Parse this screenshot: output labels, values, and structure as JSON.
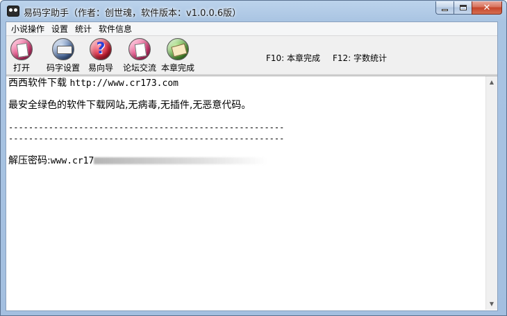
{
  "window": {
    "title": "易码字助手（作者：创世魂，软件版本：v1.0.0.6版）",
    "minimize_glyph": "–",
    "maximize_glyph": "□",
    "close_glyph": "✕"
  },
  "menu": {
    "items": [
      "小说操作",
      "设置",
      "统计",
      "软件信息"
    ]
  },
  "toolbar": {
    "buttons": [
      {
        "label": "打开",
        "icon": "open-file-icon"
      },
      {
        "label": "码字设置",
        "icon": "settings-icon"
      },
      {
        "label": "易向导",
        "icon": "wizard-help-icon"
      },
      {
        "label": "论坛交流",
        "icon": "forum-icon"
      },
      {
        "label": "本章完成",
        "icon": "chapter-complete-icon"
      }
    ],
    "hotkeys": [
      "F10: 本章完成",
      "F12: 字数统计"
    ]
  },
  "editor": {
    "line1": "西西软件下载 ",
    "line1_url": "http://www.cr173.com",
    "line2": "最安全绿色的软件下载网站,无病毒,无插件,无恶意代码。",
    "separator": "-------------------------------------------------------",
    "password_label": "解压密码:",
    "password_value": "www.cr17"
  },
  "scrollbar": {
    "up_arrow": "▲",
    "down_arrow": "▼"
  }
}
